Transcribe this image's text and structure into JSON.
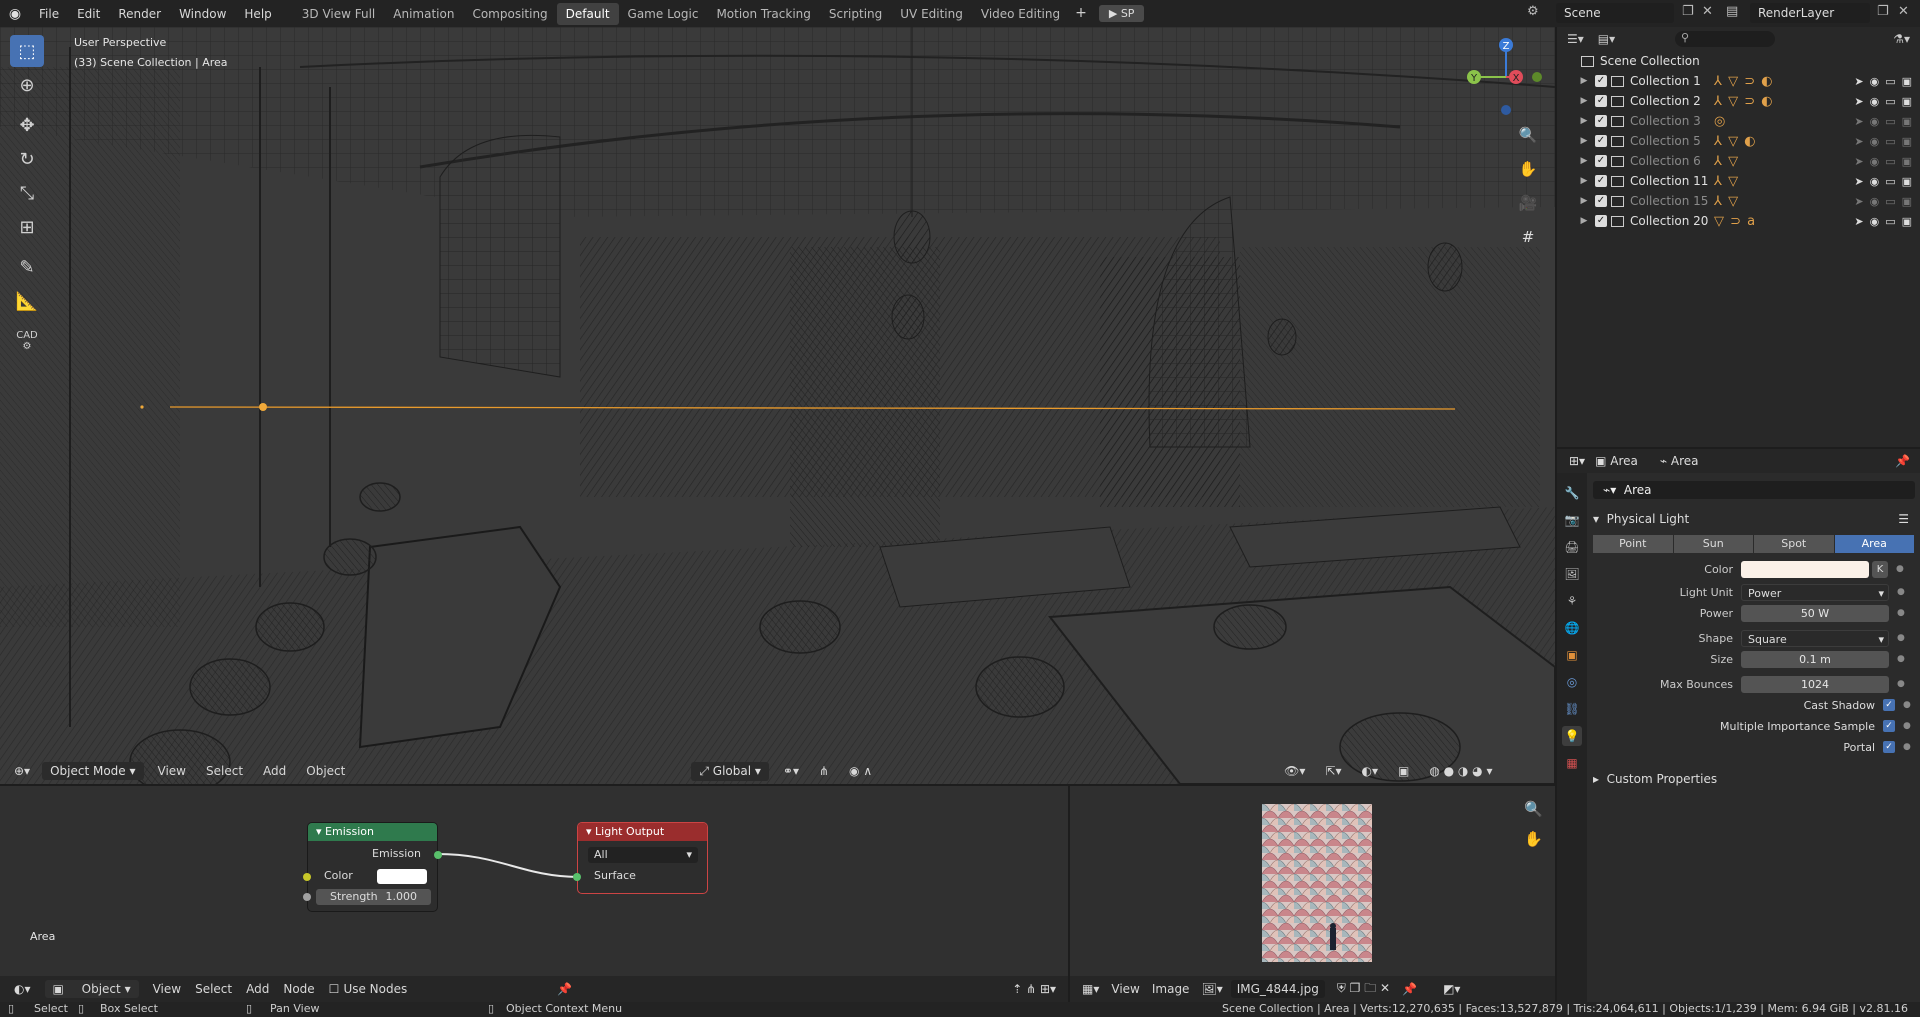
{
  "topbar": {
    "menu": [
      "File",
      "Edit",
      "Render",
      "Window",
      "Help"
    ],
    "workspaces": [
      "3D View Full",
      "Animation",
      "Compositing",
      "Default",
      "Game Logic",
      "Motion Tracking",
      "Scripting",
      "UV Editing",
      "Video Editing"
    ],
    "active_workspace": "Default",
    "play_label": "SP",
    "scene": "Scene",
    "render_layer": "RenderLayer"
  },
  "viewport": {
    "perspective": "User Perspective",
    "collection_info": "(33) Scene Collection | Area",
    "mode": "Object Mode",
    "menu": [
      "View",
      "Select",
      "Add",
      "Object"
    ],
    "transform_orientation": "Global",
    "cad_label": "CAD",
    "gizmo": {
      "x": "X",
      "y": "Y",
      "z": "Z"
    }
  },
  "outliner": {
    "root": "Scene Collection",
    "collections": [
      {
        "name": "Collection 1",
        "dim": false
      },
      {
        "name": "Collection 2",
        "dim": false
      },
      {
        "name": "Collection 3",
        "dim": true
      },
      {
        "name": "Collection 5",
        "dim": true
      },
      {
        "name": "Collection 6",
        "dim": true
      },
      {
        "name": "Collection 11",
        "dim": false
      },
      {
        "name": "Collection 15",
        "dim": true
      },
      {
        "name": "Collection 20",
        "dim": false
      }
    ]
  },
  "properties": {
    "object_name": "Area",
    "data_name": "Area",
    "light_name": "Area",
    "panel_title": "Physical Light",
    "light_types": [
      "Point",
      "Sun",
      "Spot",
      "Area"
    ],
    "active_type": "Area",
    "color_label": "Color",
    "color_value": "#fbf1e8",
    "k_label": "K",
    "light_unit_label": "Light Unit",
    "light_unit": "Power",
    "power_label": "Power",
    "power": "50 W",
    "shape_label": "Shape",
    "shape": "Square",
    "size_label": "Size",
    "size": "0.1 m",
    "max_bounces_label": "Max Bounces",
    "max_bounces": "1024",
    "cast_shadow": "Cast Shadow",
    "mis": "Multiple Importance Sample",
    "portal": "Portal",
    "custom_props": "Custom Properties"
  },
  "node_editor": {
    "emission_node": {
      "title": "Emission",
      "output": "Emission",
      "color": "Color",
      "strength_label": "Strength",
      "strength": "1.000"
    },
    "output_node": {
      "title": "Light Output",
      "target": "All",
      "surface": "Surface"
    },
    "area_label": "Area",
    "footer": {
      "type": "Object",
      "menu": [
        "View",
        "Select",
        "Add",
        "Node"
      ],
      "use_nodes": "Use Nodes"
    }
  },
  "image_editor": {
    "menu": [
      "View",
      "Image"
    ],
    "image_name": "IMG_4844.jpg"
  },
  "statusbar": {
    "select": "Select",
    "box_select": "Box Select",
    "pan_view": "Pan View",
    "context_menu": "Object Context Menu",
    "stats": "Scene Collection | Area | Verts:12,270,635 | Faces:13,527,879 | Tris:24,064,611 | Objects:1/1,239 | Mem: 6.94 GiB | v2.81.16"
  }
}
